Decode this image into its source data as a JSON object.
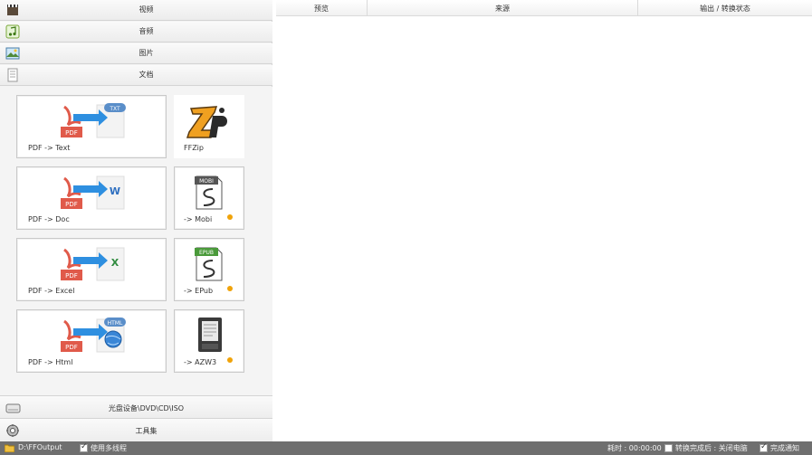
{
  "categories": [
    {
      "label": "视频",
      "icon": "video-icon"
    },
    {
      "label": "音频",
      "icon": "audio-icon"
    },
    {
      "label": "图片",
      "icon": "image-icon"
    },
    {
      "label": "文档",
      "icon": "document-icon"
    }
  ],
  "tiles": {
    "pdf_text": {
      "label": "PDF -> Text",
      "badge": "TXT"
    },
    "ffzip": {
      "label": "FFZip"
    },
    "pdf_doc": {
      "label": "PDF -> Doc",
      "badge": "W"
    },
    "mobi": {
      "label": "-> Mobi",
      "badge": "MOBI"
    },
    "pdf_excel": {
      "label": "PDF -> Excel",
      "badge": "X"
    },
    "epub": {
      "label": "-> EPub",
      "badge": "EPUB"
    },
    "pdf_html": {
      "label": "PDF -> Html",
      "badge": "HTML"
    },
    "azw3": {
      "label": "-> AZW3"
    },
    "pdf_badge": "PDF"
  },
  "bottom_categories": [
    {
      "label": "光盘设备\\DVD\\CD\\ISO",
      "icon": "disc-drive-icon"
    },
    {
      "label": "工具集",
      "icon": "tools-icon"
    }
  ],
  "table": {
    "columns": [
      "预览",
      "来源",
      "输出 / 转换状态"
    ]
  },
  "status": {
    "output_path": "D:\\FFOutput",
    "multithread_label": "使用多线程",
    "multithread_checked": true,
    "elapsed": "耗时 : 00:00:00",
    "after_done_label": "转换完成后 : 关闭电脑",
    "after_done_checked": false,
    "notify_label": "完成通知",
    "notify_checked": true
  },
  "colors": {
    "pdf_red": "#e05a4a",
    "arrow_blue": "#2e8fe0",
    "status_bar": "#6f6f6f",
    "dot_orange": "#f0a30a"
  }
}
